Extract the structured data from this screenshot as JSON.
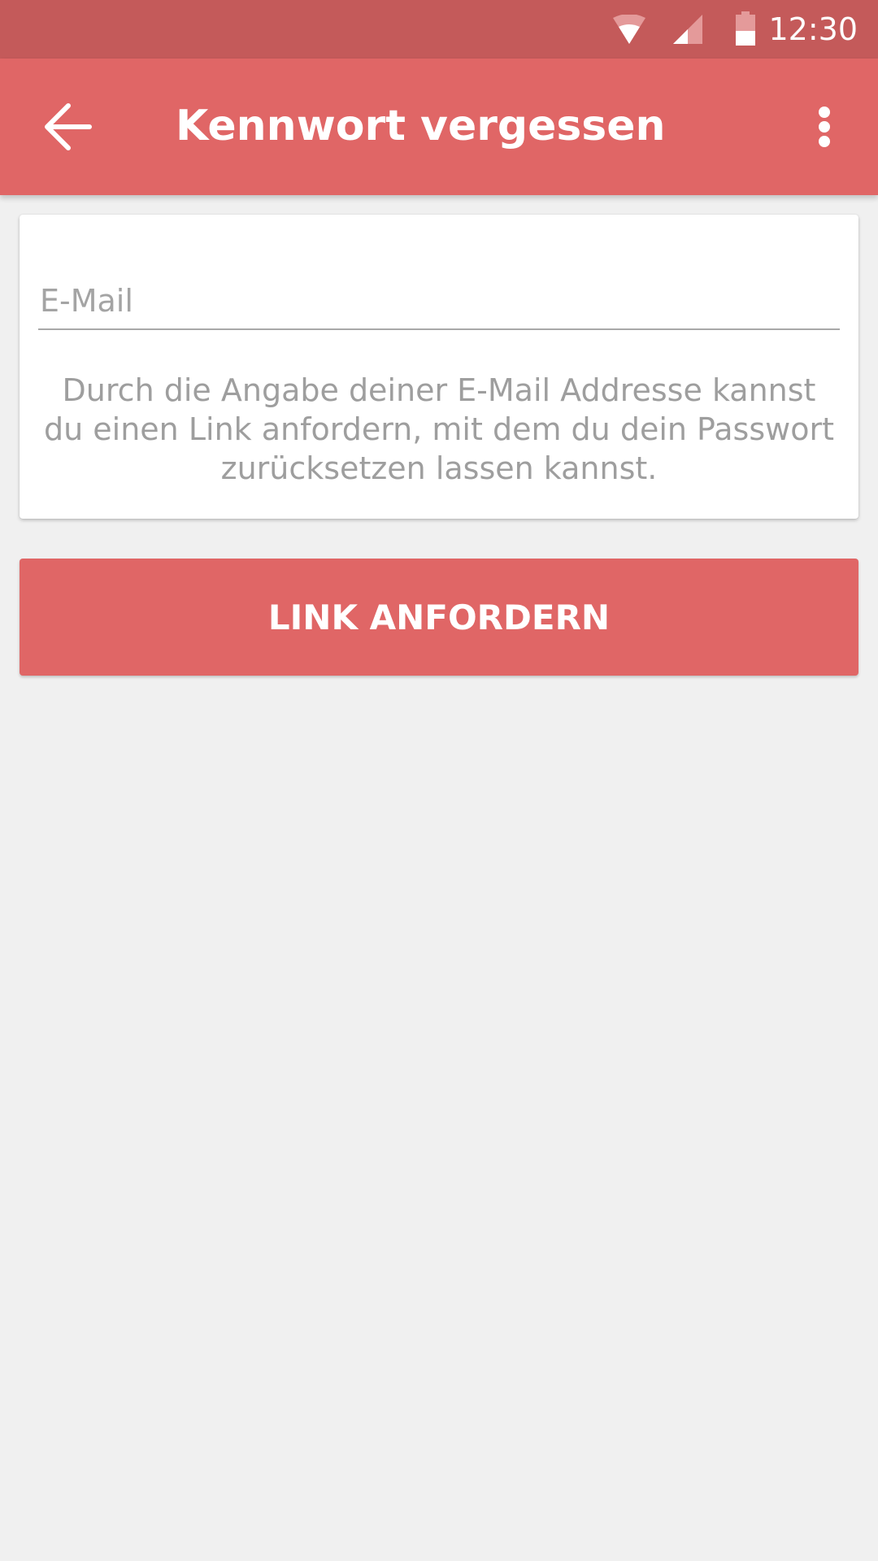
{
  "status_bar": {
    "time": "12:30",
    "icons": [
      "wifi-icon",
      "cellular-signal-icon",
      "battery-icon"
    ]
  },
  "app_bar": {
    "back_icon": "arrow-back-icon",
    "title": "Kennwort vergessen",
    "overflow_icon": "more-vert-icon"
  },
  "form": {
    "email": {
      "value": "",
      "placeholder": "E-Mail"
    },
    "hint": "Durch die Angabe deiner E-Mail Addresse kannst du einen Link anfordern, mit dem du dein Passwort zurücksetzen lassen kannst.",
    "submit_label": "LINK ANFORDERN"
  },
  "colors": {
    "status_bar": "#c45a5a",
    "primary": "#e06666",
    "background": "#f0f0f0",
    "card": "#ffffff",
    "hint_text": "#9e9e9e"
  }
}
